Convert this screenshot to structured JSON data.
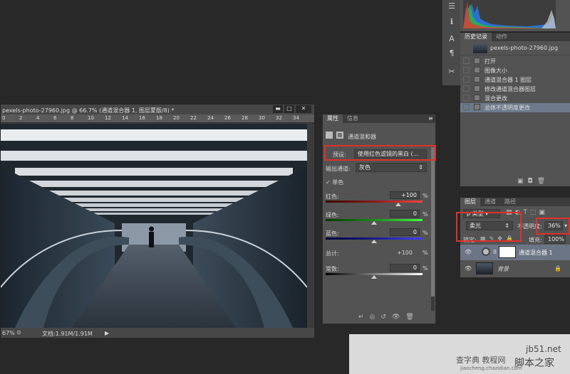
{
  "document": {
    "title": "pexels-photo-27960.jpg @ 66.7% (通道混合器 1, 图层蒙版/8) *",
    "zoom": "67%",
    "doc_info": "文档:1.91M/1.91M",
    "ruler_ticks": [
      "0",
      "2",
      "4",
      "6",
      "8",
      "10",
      "12",
      "14",
      "16",
      "18",
      "20",
      "22",
      "24",
      "26",
      "28",
      "30",
      "32",
      "34"
    ]
  },
  "history_panel": {
    "tabs": [
      "历史记录",
      "动作"
    ],
    "snapshot": "pexels-photo-27960.jpg",
    "items": [
      "打开",
      "图像大小",
      "通道混合器 1 图层",
      "修改通道混合器图层",
      "混合更改",
      "总体不透明度更改"
    ]
  },
  "properties_panel": {
    "tabs": [
      "属性",
      "信息"
    ],
    "header": "通道混和器",
    "preset_label": "预设:",
    "preset_value": "使用红色滤镜的黑白 (...",
    "output_label": "输出通道:",
    "output_value": "灰色",
    "mono_label": "单色",
    "red_label": "红色:",
    "red_value": "+100",
    "green_label": "绿色:",
    "green_value": "0",
    "blue_label": "蓝色:",
    "blue_value": "0",
    "total_label": "总计:",
    "total_value": "+100",
    "constant_label": "常数:",
    "constant_value": "0",
    "percent": "%",
    "red_slider_fraction": 0.75,
    "green_slider_fraction": 0.5,
    "blue_slider_fraction": 0.5,
    "constant_slider_fraction": 0.5
  },
  "layers_panel": {
    "tabs": [
      "图层",
      "通道",
      "路径"
    ],
    "kind_value": "类型",
    "blend_mode": "柔光",
    "opacity_label": "不透明度:",
    "opacity_value": "36%",
    "lock_label": "锁定:",
    "fill_label": "填充:",
    "fill_value": "100%",
    "layers": [
      {
        "name": "通道混合器 1"
      },
      {
        "name": "背景"
      }
    ]
  },
  "watermark": {
    "site": "jb51.net",
    "brand": "脚本之家",
    "sub": "查字典 教程网",
    "url": "jiaocheng.chazidian.com"
  }
}
